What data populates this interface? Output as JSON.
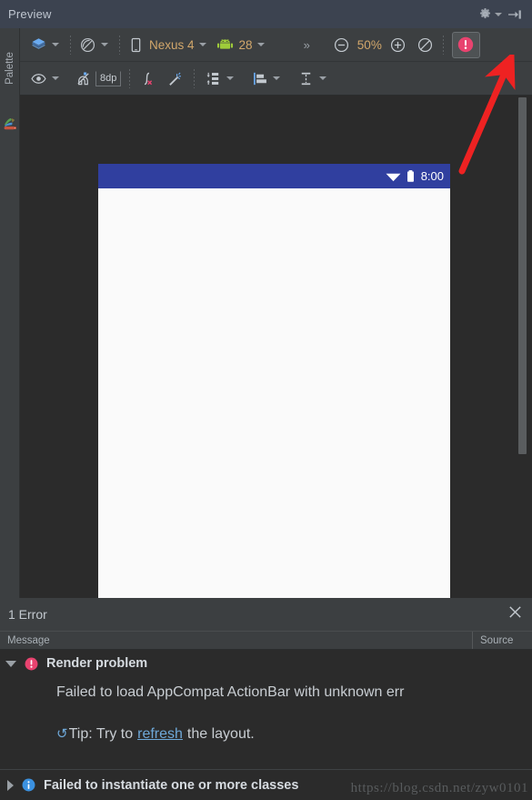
{
  "titlebar": {
    "title": "Preview",
    "gear_icon": "gear-icon",
    "collapse_icon": "collapse-panel-icon"
  },
  "sidebar": {
    "palette_label": "Palette",
    "palette_icon": "palette-icon"
  },
  "toolbar_row1": {
    "design_mode_icon": "layers-icon",
    "orientation_icon": "rotate-orientation-icon",
    "device_icon": "phone-icon",
    "device_name": "Nexus 4",
    "api_icon": "android-robot-icon",
    "api_level": "28",
    "overflow": "»",
    "zoom_out_icon": "zoom-out-icon",
    "zoom_level": "50%",
    "zoom_in_icon": "zoom-in-icon",
    "zoom_fit_icon": "zoom-to-fit-icon",
    "error_badge_icon": "error-badge-icon"
  },
  "toolbar_row2": {
    "show_constraints_icon": "eye-icon",
    "autoconnect_icon": "magnet-off-icon",
    "default_margin": "8dp",
    "clear_constraints_icon": "clear-constraints-icon",
    "infer_constraints_icon": "magic-wand-icon",
    "pack_icon": "pack-distribute-icon",
    "align_icon": "align-left-icon",
    "guideline_icon": "guideline-icon"
  },
  "canvas": {
    "device_status_time": "8:00",
    "wifi_icon": "wifi-icon",
    "battery_icon": "battery-icon",
    "statusbar_color": "#303f9f",
    "device_background": "#fafafa",
    "scrollbar": "vertical-scrollbar"
  },
  "annotation": {
    "arrow_color": "#ee2222",
    "arrow_icon": "red-pointer-arrow"
  },
  "error_panel": {
    "header_title": "1 Error",
    "close_icon": "close-icon",
    "columns": {
      "message": "Message",
      "source": "Source"
    },
    "rows": [
      {
        "expanded": true,
        "icon": "error-circle-icon",
        "title": "Render problem",
        "detail": "Failed to load AppCompat ActionBar with unknown err",
        "tip_prefix": "Tip: Try to",
        "tip_link": "refresh",
        "tip_suffix": "the layout.",
        "tip_icon": "refresh-icon"
      },
      {
        "expanded": false,
        "icon": "info-circle-icon",
        "title": "Failed to instantiate one or more classes"
      }
    ]
  },
  "watermark": "https://blog.csdn.net/zyw0101"
}
